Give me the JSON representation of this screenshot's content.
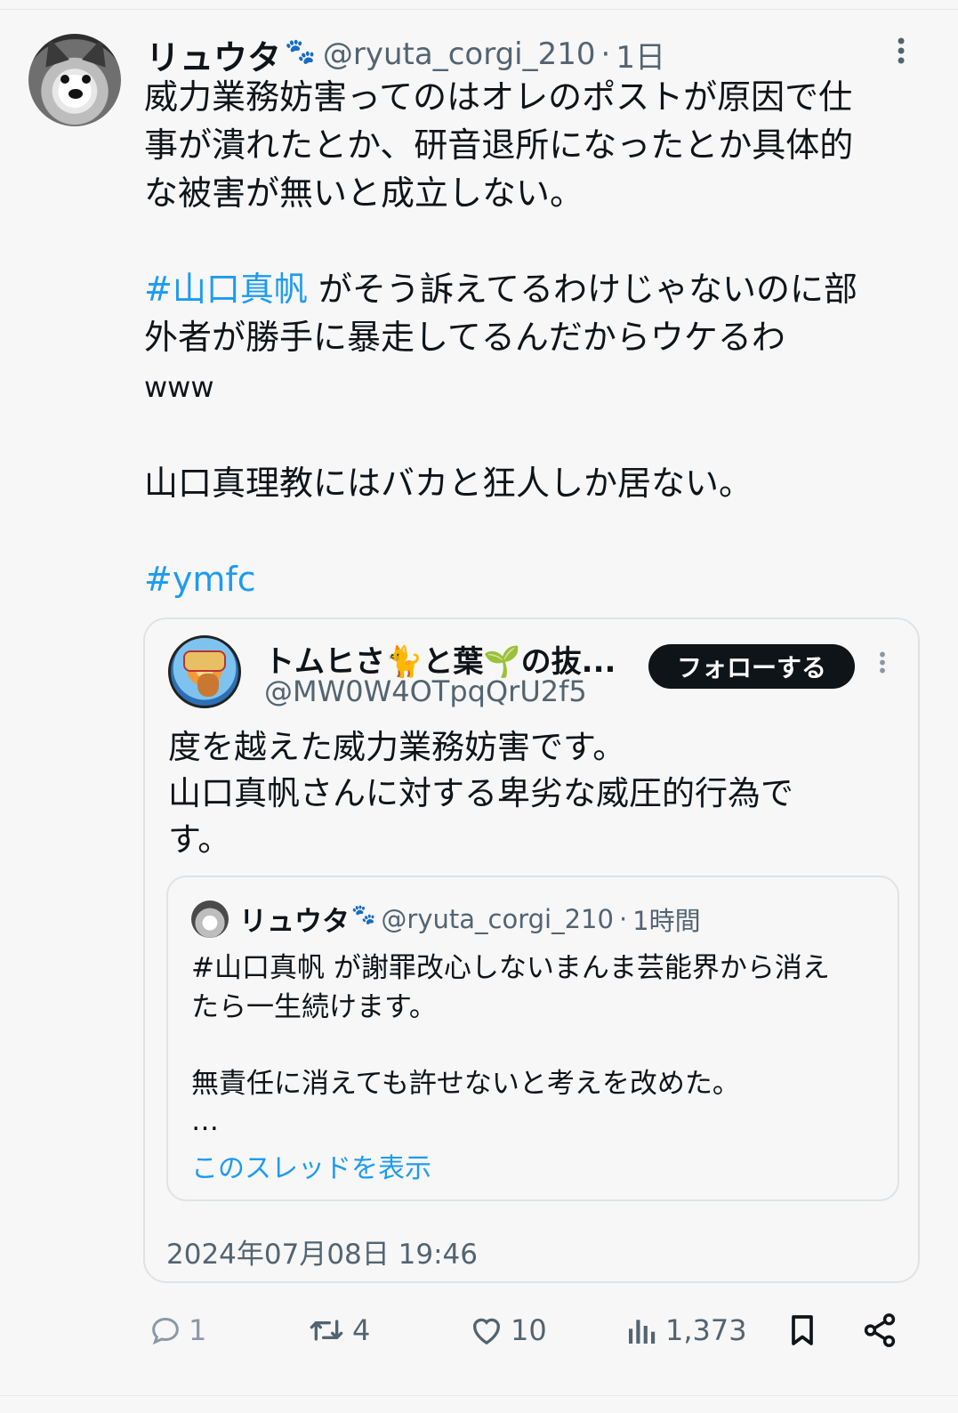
{
  "tweet": {
    "display_name": "リュウタ",
    "paw_emoji": "🐾",
    "handle": "@ryuta_corgi_210",
    "separator": "·",
    "time": "1日",
    "lines": [
      "威力業務妨害ってのはオレのポストが原因で仕",
      "事が潰れたとか、研音退所になったとか具体的",
      "な被害が無いと成立しない。"
    ],
    "hashtag_1": "#山口真帆",
    "line_after_hashtag": " がそう訴えてるわけじゃないのに部",
    "line_5": "外者が勝手に暴走してるんだからウケるわ",
    "line_6": "www",
    "line_7": "山口真理教にはバカと狂人しか居ない。",
    "hashtag_2": "#ymfc"
  },
  "quote": {
    "display_name": "トムヒさ🐈と葉🌱の抜...",
    "handle": "@MW0W4OTpqQrU2f5",
    "follow_label": "フォローする",
    "lines": [
      "度を越えた威力業務妨害です。",
      "山口真帆さんに対する卑劣な威圧的行為で",
      "す。"
    ],
    "timestamp": "2024年07月08日 19:46",
    "nested": {
      "display_name": "リュウタ",
      "paw_emoji": "🐾",
      "handle": "@ryuta_corgi_210",
      "separator": "·",
      "time": "1時間",
      "lines": [
        "#山口真帆 が謝罪改心しないまんま芸能界から消え",
        "たら一生続けます。",
        "無責任に消えても許せないと考えを改めた。",
        "…"
      ],
      "show_thread": "このスレッドを表示"
    }
  },
  "actions": {
    "replies": "1",
    "reposts": "4",
    "likes": "10",
    "views": "1,373"
  },
  "icons": {
    "reply": "reply-icon",
    "repost": "repost-icon",
    "like": "heart-icon",
    "views": "views-chart-icon",
    "bookmark": "bookmark-icon",
    "share": "share-icon",
    "more": "more-dots-icon"
  },
  "colors": {
    "link": "#1d9bf0",
    "text": "#0f1419",
    "muted": "#536471",
    "background": "#f7f7f7"
  }
}
